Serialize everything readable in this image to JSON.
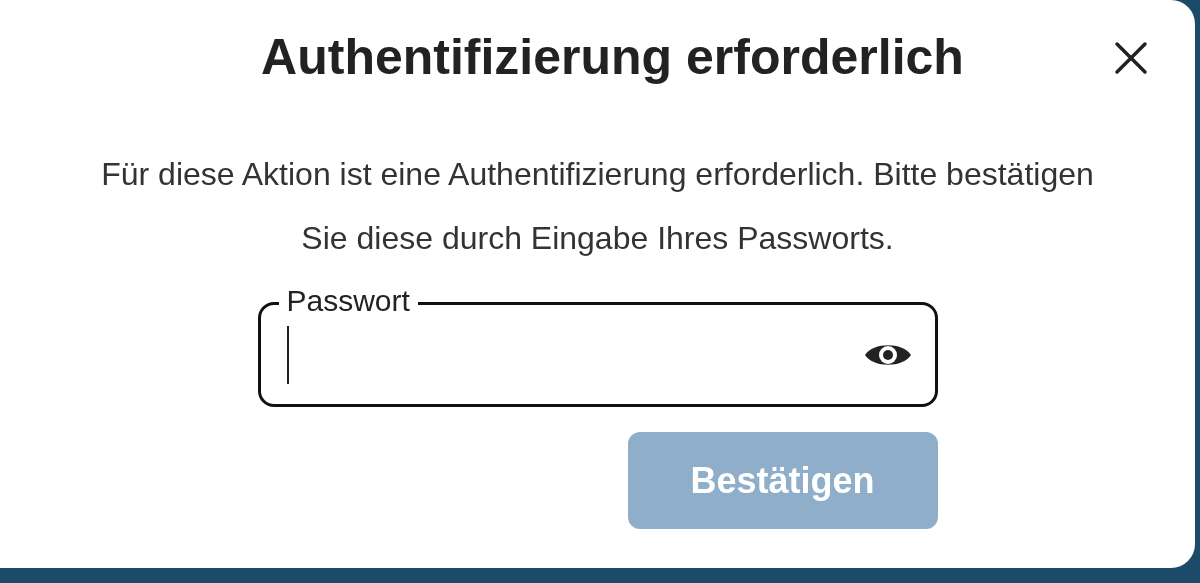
{
  "dialog": {
    "title": "Authentifizierung erforderlich",
    "message": "Für diese Aktion ist eine Authentifizierung erforderlich. Bitte bestätigen Sie diese durch Eingabe Ihres Passworts.",
    "password_field": {
      "label": "Passwort",
      "focused": true
    },
    "confirm_button": {
      "label": "Bestätigen",
      "disabled": true
    }
  }
}
